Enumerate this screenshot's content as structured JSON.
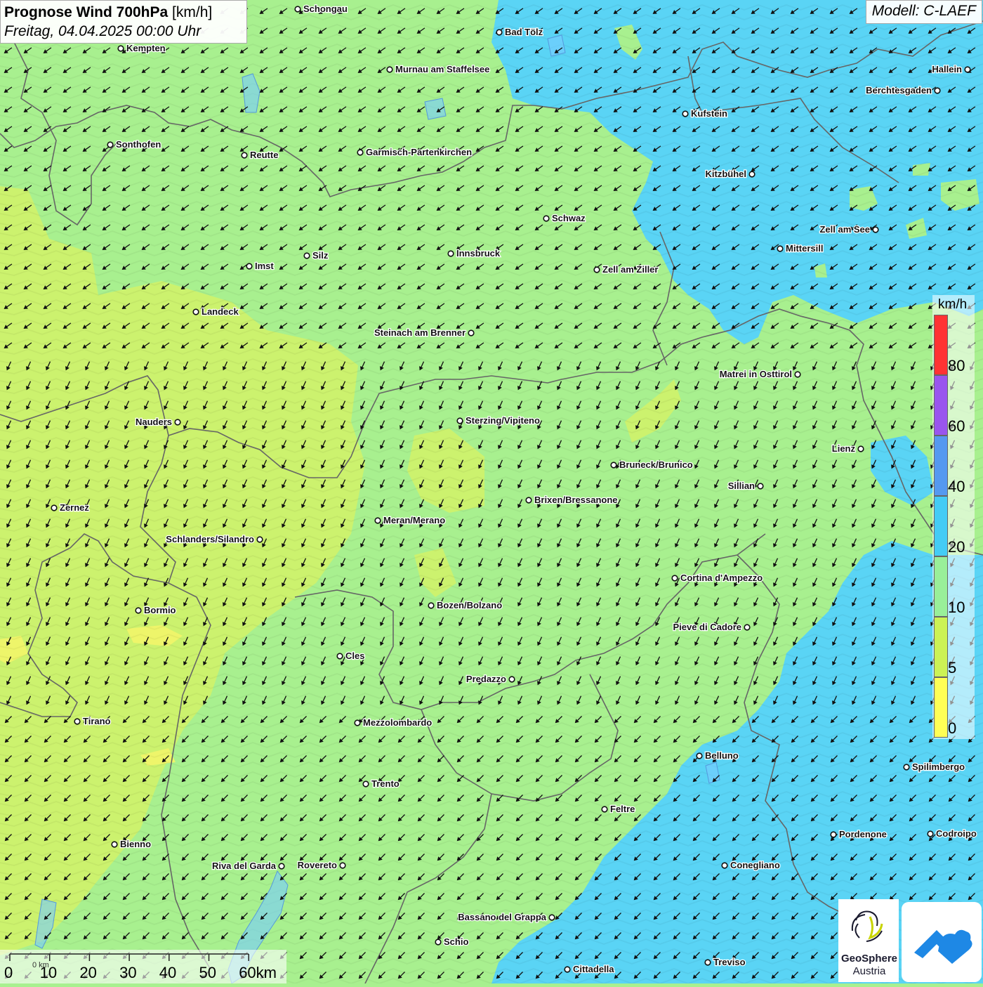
{
  "title": {
    "main_bold": "Prognose Wind 700hPa",
    "main_unit": "[km/h]",
    "date_line": "Freitag, 04.04.2025 00:00 Uhr"
  },
  "model": "Modell: C-LAEF",
  "legend": {
    "unit": "km/h",
    "classes": [
      {
        "label": "0",
        "color": "#ffff55"
      },
      {
        "label": "5",
        "color": "#ccf255"
      },
      {
        "label": "10",
        "color": "#99ef99"
      },
      {
        "label": "20",
        "color": "#44ccf5"
      },
      {
        "label": "40",
        "color": "#5599f0"
      },
      {
        "label": "60",
        "color": "#9955ee"
      },
      {
        "label": "80",
        "color": "#ff3333"
      }
    ]
  },
  "scalebar": {
    "labels": [
      "0",
      "10",
      "20",
      "30",
      "40",
      "50",
      "60km"
    ],
    "sublabel": "0 km"
  },
  "cities": [
    {
      "name": "Schongau"
    },
    {
      "name": "Bad Tölz"
    },
    {
      "name": "Kempten"
    },
    {
      "name": "Murnau am Staffelsee"
    },
    {
      "name": "Hallein"
    },
    {
      "name": "Berchtesgaden"
    },
    {
      "name": "Kufstein"
    },
    {
      "name": "Sonthofen"
    },
    {
      "name": "Reutte"
    },
    {
      "name": "Garmisch-Partenkirchen"
    },
    {
      "name": "Kitzbühel"
    },
    {
      "name": "Schwaz"
    },
    {
      "name": "Zell am See"
    },
    {
      "name": "Mittersill"
    },
    {
      "name": "Silz"
    },
    {
      "name": "Innsbruck"
    },
    {
      "name": "Imst"
    },
    {
      "name": "Zell am Ziller"
    },
    {
      "name": "Landeck"
    },
    {
      "name": "Steinach am Brenner"
    },
    {
      "name": "Matrei in Osttirol"
    },
    {
      "name": "Nauders"
    },
    {
      "name": "Sterzing/Vipiteno"
    },
    {
      "name": "Lienz"
    },
    {
      "name": "Bruneck/Brunico"
    },
    {
      "name": "Sillian"
    },
    {
      "name": "Zernez"
    },
    {
      "name": "Brixen/Bressanone"
    },
    {
      "name": "Meran/Merano"
    },
    {
      "name": "Schlanders/Silandro"
    },
    {
      "name": "Cortina d'Ampezzo"
    },
    {
      "name": "Bozen/Bolzano"
    },
    {
      "name": "Bormio"
    },
    {
      "name": "Pieve di Cadore"
    },
    {
      "name": "Cles"
    },
    {
      "name": "Predazzo"
    },
    {
      "name": "Tirano"
    },
    {
      "name": "Mezzolombardo"
    },
    {
      "name": "Belluno"
    },
    {
      "name": "Spilimbergo"
    },
    {
      "name": "Trento"
    },
    {
      "name": "Feltre"
    },
    {
      "name": "Pordenone"
    },
    {
      "name": "Codroipo"
    },
    {
      "name": "Bienno"
    },
    {
      "name": "Riva del Garda"
    },
    {
      "name": "Rovereto"
    },
    {
      "name": "Conegliano"
    },
    {
      "name": "Bassano del Grappa"
    },
    {
      "name": "Schio"
    },
    {
      "name": "Treviso"
    },
    {
      "name": "Cittadella"
    }
  ],
  "logo": {
    "line1": "GeoSphere",
    "line2": "Austria"
  }
}
